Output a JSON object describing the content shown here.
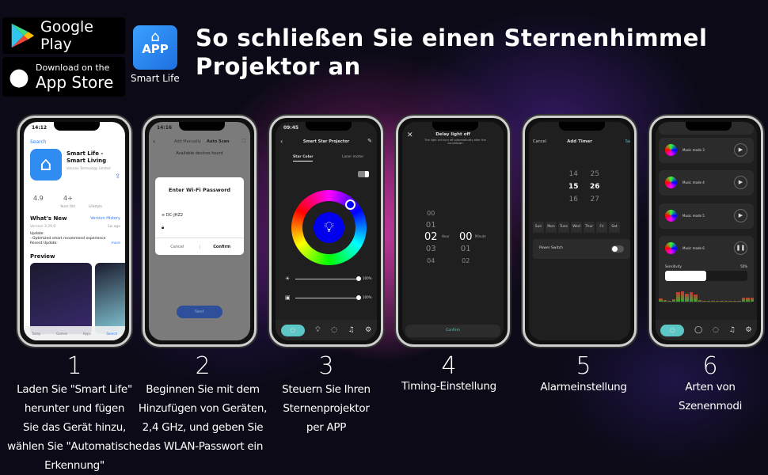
{
  "header": {
    "title_line1": "So schließen Sie einen Sternenhimmel",
    "title_line2": "Projektor an"
  },
  "badges": {
    "google_play": "Google Play",
    "app_store_small": "Download on the",
    "app_store": "App Store",
    "app_icon_text": "APP",
    "app_name": "Smart Life"
  },
  "colors": {
    "accent": "#5cc7c4",
    "app_blue": "#2f8cf0"
  },
  "steps": [
    {
      "number": "1",
      "caption": [
        "Laden Sie \"Smart Life\"",
        "herunter und fügen",
        "Sie das Gerät hinzu,",
        "wählen Sie \"Automatische",
        "Erkennung\""
      ]
    },
    {
      "number": "2",
      "caption": [
        "Beginnen Sie mit dem",
        "Hinzufügen von Geräten,",
        "2,4 GHz, und geben Sie",
        "das WLAN-Passwort ein"
      ]
    },
    {
      "number": "3",
      "caption": [
        "Steuern Sie Ihren",
        "Sternenprojektor",
        "per APP"
      ]
    },
    {
      "number": "4",
      "caption": [
        "Timing-Einstellung"
      ]
    },
    {
      "number": "5",
      "caption": [
        "Alarmeinstellung"
      ]
    },
    {
      "number": "6",
      "caption": [
        "Arten von",
        "Szenenmodi"
      ]
    }
  ],
  "screen1": {
    "time": "14:12",
    "back": "Search",
    "app_title": "Smart Life -",
    "app_subtitle": "Smart Living",
    "developer": "Volcano Technology Limited",
    "rating": "4.9",
    "age": "4+",
    "age_label": "Years Old",
    "category": "Lifestyle",
    "whats_new": "What's New",
    "version_history": "Version History",
    "version": "Version 3.29.0",
    "ago": "1w ago",
    "update_lines": [
      "Update:",
      "- Optimized smart recommend experience",
      "Recent Update:"
    ],
    "more": "more",
    "preview": "Preview",
    "tabs": [
      "Today",
      "Games",
      "Apps",
      "Search"
    ]
  },
  "screen2": {
    "time": "14:16",
    "tab_manual": "Add Manually",
    "tab_auto": "Auto Scan",
    "found": "Available devices found",
    "dialog_title": "Enter Wi-Fi Password",
    "ssid": "DC-JHZ2",
    "cancel": "Cancel",
    "confirm": "Confirm",
    "next": "Next"
  },
  "screen3": {
    "time": "09:45",
    "title": "Smart Star Projector",
    "tab_star": "Star Color",
    "tab_laser": "Laser motor",
    "brightness": "100%",
    "speed": "100%",
    "brightness_value": 100,
    "speed_value": 100
  },
  "screen4": {
    "title": "Delay light off",
    "subtitle": "The light will turn off automatically after the countdown",
    "hours": [
      "00",
      "01",
      "02",
      "03",
      "04"
    ],
    "minutes": [
      "00",
      "01",
      "02"
    ],
    "hour_label": "Hour",
    "minute_label": "Minute",
    "confirm": "Confirm"
  },
  "screen5": {
    "cancel": "Cancel",
    "title": "Add Timer",
    "save": "Sa",
    "hours": [
      "14",
      "15",
      "16"
    ],
    "minutes": [
      "25",
      "26",
      "27"
    ],
    "days": [
      "Sun",
      "Mon",
      "Tues",
      "Wed",
      "Thur",
      "Fri",
      "Sat"
    ],
    "power_switch": "Power Switch"
  },
  "screen6": {
    "modes": [
      "Music mode 3",
      "Music mode 4",
      "Music mode 5",
      "Music mode 6"
    ],
    "sensitivity": "Sensitivity",
    "sensitivity_value": "50%",
    "sensitivity_fraction": 0.5
  }
}
